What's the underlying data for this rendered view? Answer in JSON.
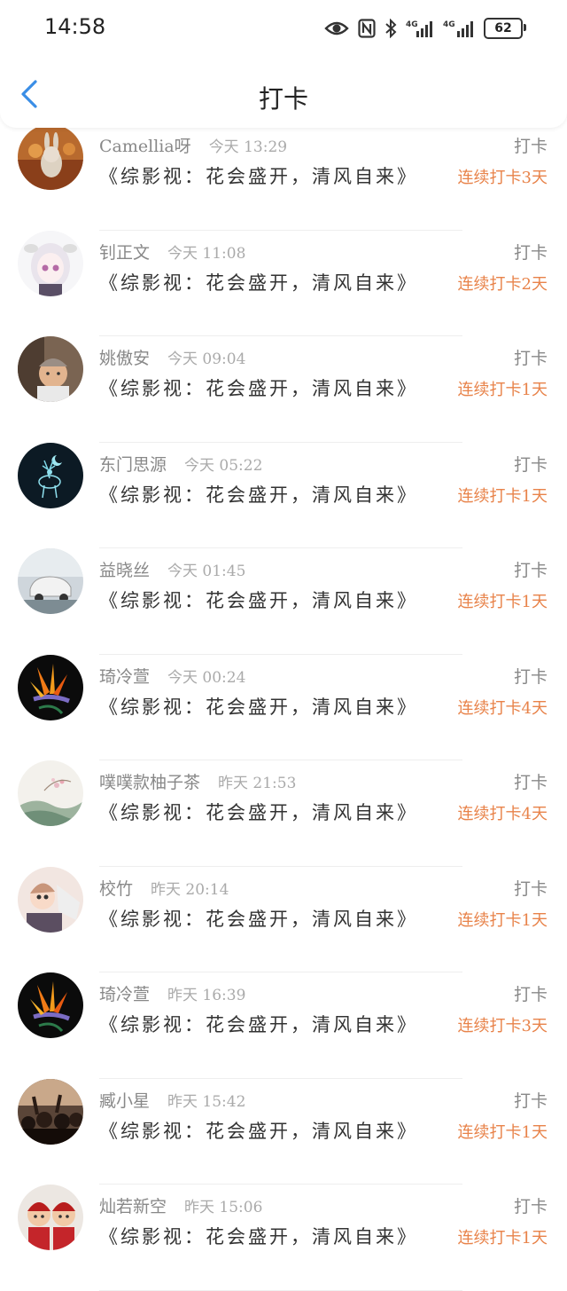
{
  "status_bar": {
    "time": "14:58",
    "battery": "62",
    "icons": [
      "eye-icon",
      "nfc-icon",
      "bluetooth-icon",
      "signal-4g-icon",
      "signal-4g-icon"
    ]
  },
  "header": {
    "title": "打卡",
    "back_icon": "chevron-left-icon",
    "accent_color": "#3a8ee6"
  },
  "colors": {
    "streak": "#e8834a",
    "muted_text": "#888888",
    "body_text": "#333333"
  },
  "list": {
    "items": [
      {
        "name": "Camellia呀",
        "time": "今天 13:29",
        "book": "《综影视：花会盛开，清风自来》",
        "label": "打卡",
        "streak": "连续打卡3天",
        "avatar": "rabbit-figure-avatar"
      },
      {
        "name": "钊正文",
        "time": "今天 11:08",
        "book": "《综影视：花会盛开，清风自来》",
        "label": "打卡",
        "streak": "连续打卡2天",
        "avatar": "anime-girl-avatar"
      },
      {
        "name": "姚傲安",
        "time": "今天 09:04",
        "book": "《综影视：花会盛开，清风自来》",
        "label": "打卡",
        "streak": "连续打卡1天",
        "avatar": "man-with-cap-avatar"
      },
      {
        "name": "东门思源",
        "time": "今天 05:22",
        "book": "《综影视：花会盛开，清风自来》",
        "label": "打卡",
        "streak": "连续打卡1天",
        "avatar": "glowing-deer-avatar"
      },
      {
        "name": "益晓丝",
        "time": "今天 01:45",
        "book": "《综影视：花会盛开，清风自来》",
        "label": "打卡",
        "streak": "连续打卡1天",
        "avatar": "white-car-avatar"
      },
      {
        "name": "琦冷萱",
        "time": "今天 00:24",
        "book": "《综影视：花会盛开，清风自来》",
        "label": "打卡",
        "streak": "连续打卡4天",
        "avatar": "bird-of-paradise-avatar"
      },
      {
        "name": "噗噗款柚子茶",
        "time": "昨天 21:53",
        "book": "《综影视：花会盛开，清风自来》",
        "label": "打卡",
        "streak": "连续打卡4天",
        "avatar": "ink-painting-avatar"
      },
      {
        "name": "校竹",
        "time": "昨天 20:14",
        "book": "《综影视：花会盛开，清风自来》",
        "label": "打卡",
        "streak": "连续打卡1天",
        "avatar": "anime-characters-avatar"
      },
      {
        "name": "琦冷萱",
        "time": "昨天 16:39",
        "book": "《综影视：花会盛开，清风自来》",
        "label": "打卡",
        "streak": "连续打卡3天",
        "avatar": "bird-of-paradise-avatar"
      },
      {
        "name": "臧小星",
        "time": "昨天 15:42",
        "book": "《综影视：花会盛开，清风自来》",
        "label": "打卡",
        "streak": "连续打卡1天",
        "avatar": "concert-crowd-avatar"
      },
      {
        "name": "灿若新空",
        "time": "昨天 15:06",
        "book": "《综影视：花会盛开，清风自来》",
        "label": "打卡",
        "streak": "连续打卡1天",
        "avatar": "dolls-avatar"
      }
    ]
  }
}
